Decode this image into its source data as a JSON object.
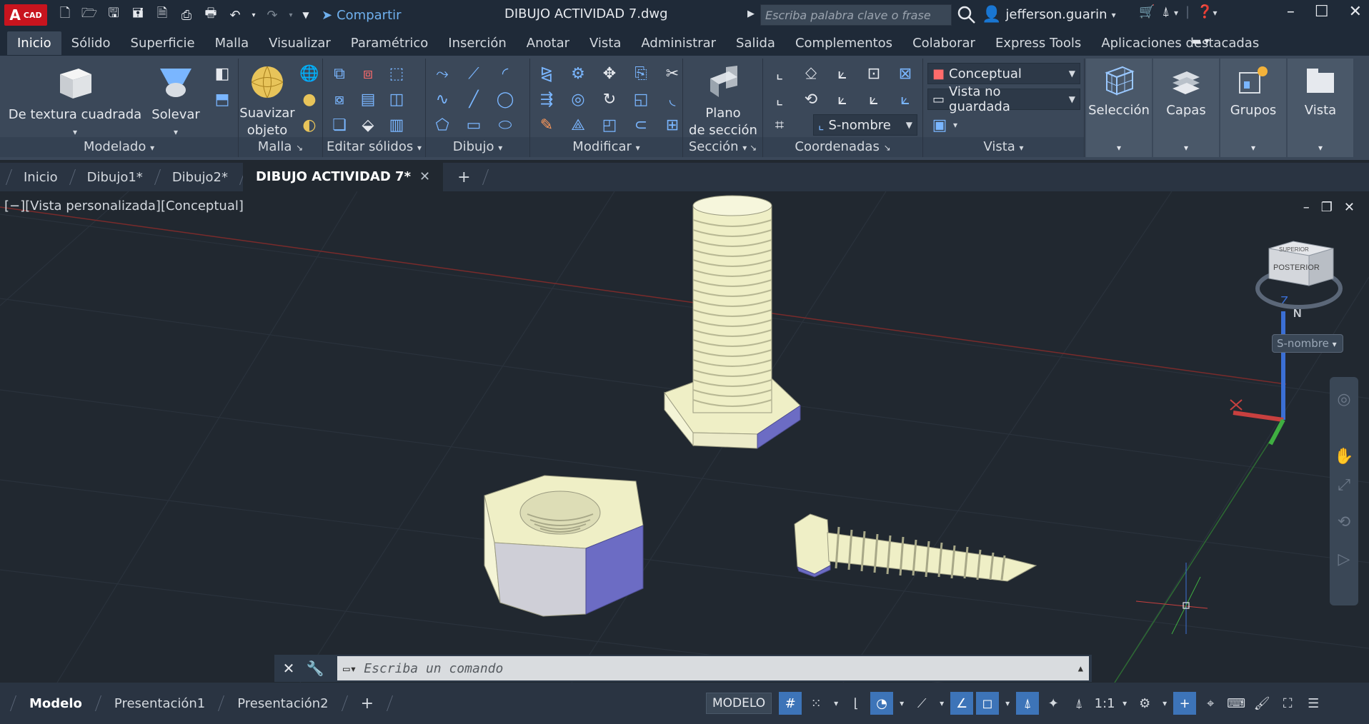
{
  "titlebar": {
    "logo_text": "CAD",
    "logo_letter": "A",
    "share_label": "Compartir",
    "doc_title": "DIBUJO ACTIVIDAD 7.dwg",
    "search_placeholder": "Escriba palabra clave o frase",
    "user_name": "jefferson.guarin",
    "icons": [
      "new-icon",
      "open-icon",
      "save-icon",
      "save-as-icon",
      "publish-icon",
      "plot-icon",
      "print-icon",
      "undo-icon",
      "redo-icon"
    ]
  },
  "ribbon_tabs": [
    "Inicio",
    "Sólido",
    "Superficie",
    "Malla",
    "Visualizar",
    "Paramétrico",
    "Inserción",
    "Anotar",
    "Vista",
    "Administrar",
    "Salida",
    "Complementos",
    "Colaborar",
    "Express Tools",
    "Aplicaciones destacadas"
  ],
  "ribbon": {
    "modelado": {
      "title": "Modelado",
      "box_label": "De textura cuadrada",
      "extrude_label": "Solevar"
    },
    "malla": {
      "title": "Malla",
      "smooth_label_1": "Suavizar",
      "smooth_label_2": "objeto"
    },
    "editar": {
      "title": "Editar sólidos"
    },
    "dibujo": {
      "title": "Dibujo"
    },
    "modificar": {
      "title": "Modificar"
    },
    "seccion": {
      "title": "Sección",
      "plane_label_1": "Plano",
      "plane_label_2": "de sección"
    },
    "coordenadas": {
      "title": "Coordenadas",
      "ucs_combo": "S-nombre"
    },
    "vista": {
      "title": "Vista",
      "visual_style": "Conceptual",
      "named_view": "Vista no guardada"
    },
    "tiles": [
      "Selección",
      "Capas",
      "Grupos",
      "Vista"
    ]
  },
  "doc_tabs": [
    "Inicio",
    "Dibujo1*",
    "Dibujo2*",
    "DIBUJO ACTIVIDAD 7*"
  ],
  "viewport": {
    "label": "[−][Vista personalizada][Conceptual]",
    "viewcube_face": "POSTERIOR",
    "viewcube_top": "SUPERIOR",
    "compass_n": "N",
    "wcs_label": "S-nombre",
    "axis_z": "Z"
  },
  "command": {
    "placeholder": "Escriba un comando"
  },
  "status": {
    "layout_tabs": [
      "Modelo",
      "Presentación1",
      "Presentación2"
    ],
    "model_badge": "MODELO",
    "scale": "1:1"
  },
  "colors": {
    "ribbon_bg": "#3b4859",
    "title_bg": "#1f2a38",
    "viewport_bg": "#212830",
    "accent": "#3d74b8",
    "solid_fill": "#efefc6",
    "solid_side": "#cfcfd7",
    "solid_shadow": "#6c6cc4"
  }
}
